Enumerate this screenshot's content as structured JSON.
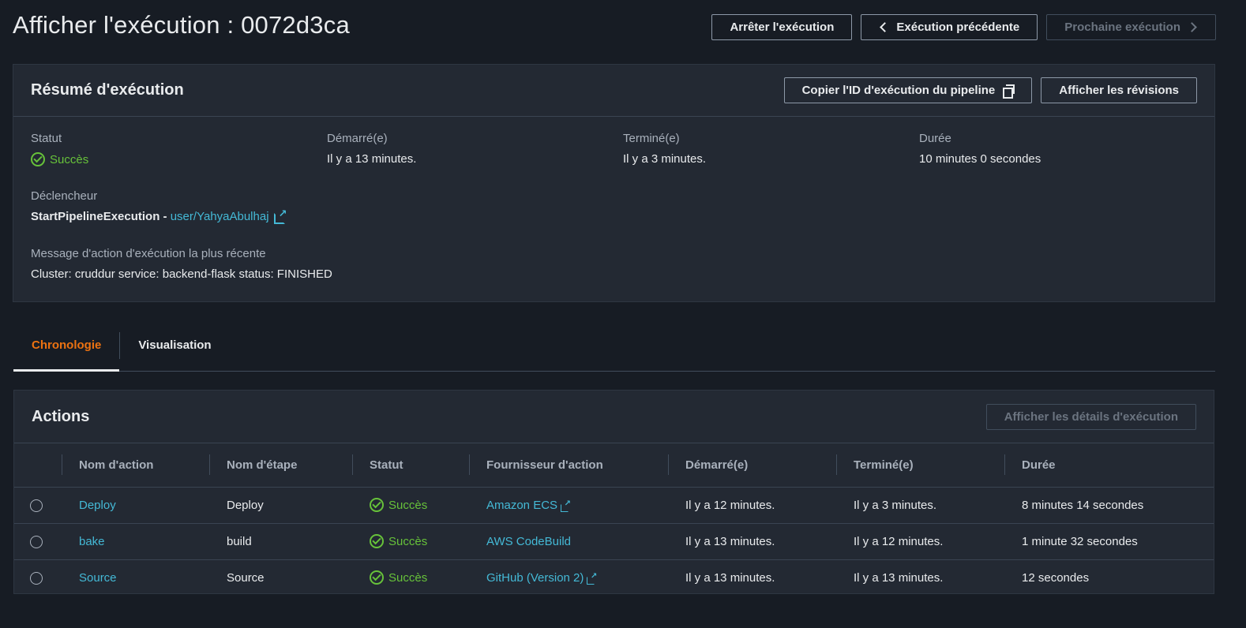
{
  "header": {
    "title": "Afficher l'exécution : 0072d3ca",
    "stop_label": "Arrêter l'exécution",
    "prev_label": "Exécution précédente",
    "next_label": "Prochaine exécution"
  },
  "summary": {
    "title": "Résumé d'exécution",
    "copy_id_label": "Copier l'ID d'exécution du pipeline",
    "revisions_label": "Afficher les révisions",
    "status_label": "Statut",
    "status_value": "Succès",
    "started_label": "Démarré(e)",
    "started_value": "Il y a 13 minutes.",
    "ended_label": "Terminé(e)",
    "ended_value": "Il y a 3 minutes.",
    "duration_label": "Durée",
    "duration_value": "10 minutes 0 secondes",
    "trigger_label": "Déclencheur",
    "trigger_value": "StartPipelineExecution - ",
    "trigger_link": "user/YahyaAbulhaj",
    "message_label": "Message d'action d'exécution la plus récente",
    "message_value": "Cluster: cruddur service: backend-flask status: FINISHED"
  },
  "tabs": [
    {
      "label": "Chronologie",
      "active": true
    },
    {
      "label": "Visualisation",
      "active": false
    }
  ],
  "actions": {
    "title": "Actions",
    "details_label": "Afficher les détails d'exécution",
    "columns": [
      "Nom d'action",
      "Nom d'étape",
      "Statut",
      "Fournisseur d'action",
      "Démarré(e)",
      "Terminé(e)",
      "Durée"
    ],
    "rows": [
      {
        "action": "Deploy",
        "stage": "Deploy",
        "status": "Succès",
        "provider": "Amazon ECS",
        "provider_external": true,
        "started": "Il y a 12 minutes.",
        "ended": "Il y a 3 minutes.",
        "duration": "8 minutes 14 secondes"
      },
      {
        "action": "bake",
        "stage": "build",
        "status": "Succès",
        "provider": "AWS CodeBuild",
        "provider_external": false,
        "started": "Il y a 13 minutes.",
        "ended": "Il y a 12 minutes.",
        "duration": "1 minute 32 secondes"
      },
      {
        "action": "Source",
        "stage": "Source",
        "status": "Succès",
        "provider": "GitHub (Version 2)",
        "provider_external": true,
        "started": "Il y a 13 minutes.",
        "ended": "Il y a 13 minutes.",
        "duration": "12 secondes"
      }
    ]
  },
  "colors": {
    "background": "#171c24",
    "panel": "#232933",
    "success": "#67c23a",
    "link": "#44b9d6",
    "active_tab": "#ec7211"
  }
}
